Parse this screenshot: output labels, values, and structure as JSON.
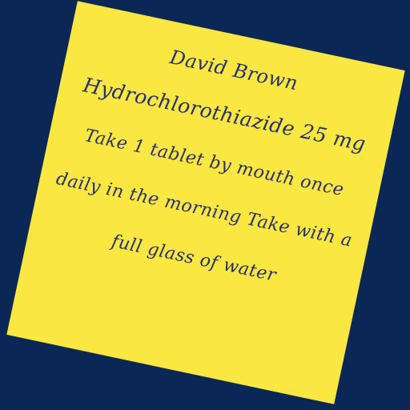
{
  "note": {
    "background_color": "#fbe741",
    "page_background_color": "#0a2756",
    "text_color": "#27306b",
    "patient_name": "David Brown",
    "medication": "Hydrochlorothiazide 25 mg",
    "instruction_line_1": "Take 1 tablet by mouth once",
    "instruction_line_2": "daily in the morning Take with a",
    "instruction_line_3": "full glass of water"
  }
}
